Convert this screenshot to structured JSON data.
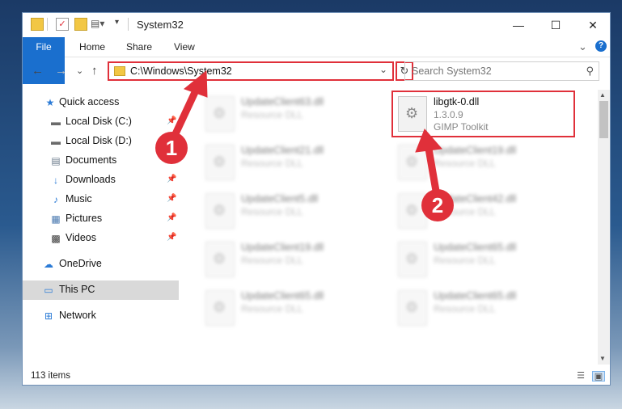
{
  "window": {
    "title": "System32",
    "controls": {
      "minimize": "—",
      "maximize": "☐",
      "close": "✕"
    }
  },
  "ribbon": {
    "tabs": [
      "File",
      "Home",
      "Share",
      "View"
    ],
    "collapse_glyph": "⌄",
    "help_glyph": "?"
  },
  "address": {
    "back_glyph": "←",
    "forward_glyph": "→",
    "recent_glyph": "⌄",
    "up_glyph": "↑",
    "path": "C:\\Windows\\System32",
    "dropdown_glyph": "⌄",
    "refresh_glyph": "↻"
  },
  "search": {
    "placeholder": "Search System32",
    "icon_glyph": "⚲"
  },
  "sidebar": {
    "items": [
      {
        "label": "Quick access",
        "icon": "star-icon",
        "glyph": "★",
        "color": "#2b7bd6",
        "pinned": false
      },
      {
        "label": "Local Disk (C:)",
        "icon": "drive-icon",
        "glyph": "▬",
        "color": "#6a6a6a",
        "pinned": true
      },
      {
        "label": "Local Disk (D:)",
        "icon": "drive-icon",
        "glyph": "▬",
        "color": "#6a6a6a",
        "pinned": false
      },
      {
        "label": "Documents",
        "icon": "documents-icon",
        "glyph": "▤",
        "color": "#6a7a8a",
        "pinned": false
      },
      {
        "label": "Downloads",
        "icon": "download-icon",
        "glyph": "↓",
        "color": "#2b7bd6",
        "pinned": true
      },
      {
        "label": "Music",
        "icon": "music-icon",
        "glyph": "♪",
        "color": "#2b7bd6",
        "pinned": true
      },
      {
        "label": "Pictures",
        "icon": "pictures-icon",
        "glyph": "▦",
        "color": "#4a7ab0",
        "pinned": true
      },
      {
        "label": "Videos",
        "icon": "videos-icon",
        "glyph": "▩",
        "color": "#333333",
        "pinned": true
      },
      {
        "label": "OneDrive",
        "icon": "cloud-icon",
        "glyph": "☁",
        "color": "#2b7bd6",
        "pinned": false
      },
      {
        "label": "This PC",
        "icon": "computer-icon",
        "glyph": "▭",
        "color": "#2b7bd6",
        "pinned": false
      },
      {
        "label": "Network",
        "icon": "network-icon",
        "glyph": "⊞",
        "color": "#2b7bd6",
        "pinned": false
      }
    ],
    "pin_glyph": "📌"
  },
  "files": {
    "highlighted": {
      "name": "libgtk-0.dll",
      "version": "1.3.0.9",
      "company": "GIMP Toolkit"
    },
    "blurred": [
      {
        "name": "UpdateClient63.dll",
        "desc": "Resource DLL"
      },
      {
        "name": "UpdateClient21.dll",
        "desc": "Resource DLL"
      },
      {
        "name": "UpdateClient19.dll",
        "desc": "Resource DLL"
      },
      {
        "name": "UpdateClient5.dll",
        "desc": "Resource DLL"
      },
      {
        "name": "UpdateClient42.dll",
        "desc": "Resource DLL"
      },
      {
        "name": "UpdateClient19.dll",
        "desc": "Resource DLL"
      },
      {
        "name": "UpdateClient65.dll",
        "desc": "Resource DLL"
      },
      {
        "name": "UpdateClient65.dll",
        "desc": "Resource DLL"
      },
      {
        "name": "UpdateClient65.dll",
        "desc": "Resource DLL"
      }
    ]
  },
  "status": {
    "item_count": "113 items"
  },
  "annotations": {
    "step1": "1",
    "step2": "2",
    "color": "#e0303a"
  }
}
